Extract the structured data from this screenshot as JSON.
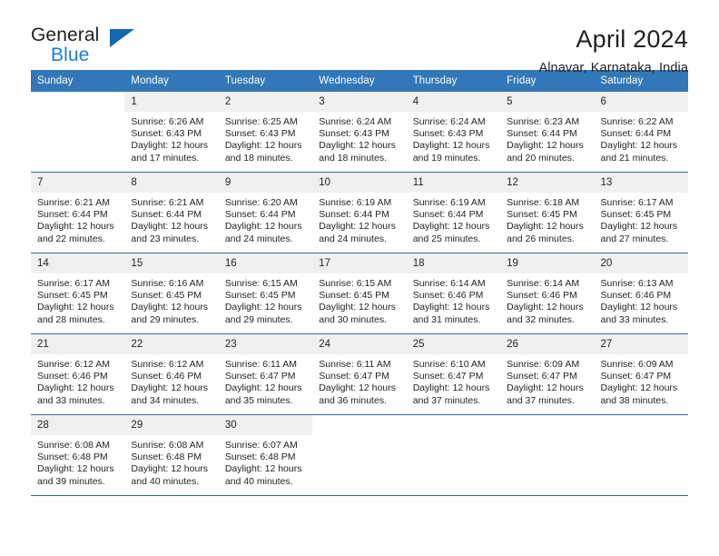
{
  "brand": {
    "name_top": "General",
    "name_bottom": "Blue",
    "triangle_color": "#1467ae",
    "blue_color": "#1b7fd1"
  },
  "header": {
    "title": "April 2024",
    "location": "Alnavar, Karnataka, India"
  },
  "theme": {
    "header_bg": "#3278b8",
    "row_divider": "#2e6da4",
    "daynum_bg": "#f0f0f0",
    "text": "#231f20"
  },
  "weekday_headers": [
    "Sunday",
    "Monday",
    "Tuesday",
    "Wednesday",
    "Thursday",
    "Friday",
    "Saturday"
  ],
  "weeks": [
    [
      {
        "day": "",
        "sunrise": "",
        "sunset": "",
        "daylight_line1": "",
        "daylight_line2": "",
        "blank": true
      },
      {
        "day": "1",
        "sunrise": "Sunrise: 6:26 AM",
        "sunset": "Sunset: 6:43 PM",
        "daylight_line1": "Daylight: 12 hours",
        "daylight_line2": "and 17 minutes."
      },
      {
        "day": "2",
        "sunrise": "Sunrise: 6:25 AM",
        "sunset": "Sunset: 6:43 PM",
        "daylight_line1": "Daylight: 12 hours",
        "daylight_line2": "and 18 minutes."
      },
      {
        "day": "3",
        "sunrise": "Sunrise: 6:24 AM",
        "sunset": "Sunset: 6:43 PM",
        "daylight_line1": "Daylight: 12 hours",
        "daylight_line2": "and 18 minutes."
      },
      {
        "day": "4",
        "sunrise": "Sunrise: 6:24 AM",
        "sunset": "Sunset: 6:43 PM",
        "daylight_line1": "Daylight: 12 hours",
        "daylight_line2": "and 19 minutes."
      },
      {
        "day": "5",
        "sunrise": "Sunrise: 6:23 AM",
        "sunset": "Sunset: 6:44 PM",
        "daylight_line1": "Daylight: 12 hours",
        "daylight_line2": "and 20 minutes."
      },
      {
        "day": "6",
        "sunrise": "Sunrise: 6:22 AM",
        "sunset": "Sunset: 6:44 PM",
        "daylight_line1": "Daylight: 12 hours",
        "daylight_line2": "and 21 minutes."
      }
    ],
    [
      {
        "day": "7",
        "sunrise": "Sunrise: 6:21 AM",
        "sunset": "Sunset: 6:44 PM",
        "daylight_line1": "Daylight: 12 hours",
        "daylight_line2": "and 22 minutes."
      },
      {
        "day": "8",
        "sunrise": "Sunrise: 6:21 AM",
        "sunset": "Sunset: 6:44 PM",
        "daylight_line1": "Daylight: 12 hours",
        "daylight_line2": "and 23 minutes."
      },
      {
        "day": "9",
        "sunrise": "Sunrise: 6:20 AM",
        "sunset": "Sunset: 6:44 PM",
        "daylight_line1": "Daylight: 12 hours",
        "daylight_line2": "and 24 minutes."
      },
      {
        "day": "10",
        "sunrise": "Sunrise: 6:19 AM",
        "sunset": "Sunset: 6:44 PM",
        "daylight_line1": "Daylight: 12 hours",
        "daylight_line2": "and 24 minutes."
      },
      {
        "day": "11",
        "sunrise": "Sunrise: 6:19 AM",
        "sunset": "Sunset: 6:44 PM",
        "daylight_line1": "Daylight: 12 hours",
        "daylight_line2": "and 25 minutes."
      },
      {
        "day": "12",
        "sunrise": "Sunrise: 6:18 AM",
        "sunset": "Sunset: 6:45 PM",
        "daylight_line1": "Daylight: 12 hours",
        "daylight_line2": "and 26 minutes."
      },
      {
        "day": "13",
        "sunrise": "Sunrise: 6:17 AM",
        "sunset": "Sunset: 6:45 PM",
        "daylight_line1": "Daylight: 12 hours",
        "daylight_line2": "and 27 minutes."
      }
    ],
    [
      {
        "day": "14",
        "sunrise": "Sunrise: 6:17 AM",
        "sunset": "Sunset: 6:45 PM",
        "daylight_line1": "Daylight: 12 hours",
        "daylight_line2": "and 28 minutes."
      },
      {
        "day": "15",
        "sunrise": "Sunrise: 6:16 AM",
        "sunset": "Sunset: 6:45 PM",
        "daylight_line1": "Daylight: 12 hours",
        "daylight_line2": "and 29 minutes."
      },
      {
        "day": "16",
        "sunrise": "Sunrise: 6:15 AM",
        "sunset": "Sunset: 6:45 PM",
        "daylight_line1": "Daylight: 12 hours",
        "daylight_line2": "and 29 minutes."
      },
      {
        "day": "17",
        "sunrise": "Sunrise: 6:15 AM",
        "sunset": "Sunset: 6:45 PM",
        "daylight_line1": "Daylight: 12 hours",
        "daylight_line2": "and 30 minutes."
      },
      {
        "day": "18",
        "sunrise": "Sunrise: 6:14 AM",
        "sunset": "Sunset: 6:46 PM",
        "daylight_line1": "Daylight: 12 hours",
        "daylight_line2": "and 31 minutes."
      },
      {
        "day": "19",
        "sunrise": "Sunrise: 6:14 AM",
        "sunset": "Sunset: 6:46 PM",
        "daylight_line1": "Daylight: 12 hours",
        "daylight_line2": "and 32 minutes."
      },
      {
        "day": "20",
        "sunrise": "Sunrise: 6:13 AM",
        "sunset": "Sunset: 6:46 PM",
        "daylight_line1": "Daylight: 12 hours",
        "daylight_line2": "and 33 minutes."
      }
    ],
    [
      {
        "day": "21",
        "sunrise": "Sunrise: 6:12 AM",
        "sunset": "Sunset: 6:46 PM",
        "daylight_line1": "Daylight: 12 hours",
        "daylight_line2": "and 33 minutes."
      },
      {
        "day": "22",
        "sunrise": "Sunrise: 6:12 AM",
        "sunset": "Sunset: 6:46 PM",
        "daylight_line1": "Daylight: 12 hours",
        "daylight_line2": "and 34 minutes."
      },
      {
        "day": "23",
        "sunrise": "Sunrise: 6:11 AM",
        "sunset": "Sunset: 6:47 PM",
        "daylight_line1": "Daylight: 12 hours",
        "daylight_line2": "and 35 minutes."
      },
      {
        "day": "24",
        "sunrise": "Sunrise: 6:11 AM",
        "sunset": "Sunset: 6:47 PM",
        "daylight_line1": "Daylight: 12 hours",
        "daylight_line2": "and 36 minutes."
      },
      {
        "day": "25",
        "sunrise": "Sunrise: 6:10 AM",
        "sunset": "Sunset: 6:47 PM",
        "daylight_line1": "Daylight: 12 hours",
        "daylight_line2": "and 37 minutes."
      },
      {
        "day": "26",
        "sunrise": "Sunrise: 6:09 AM",
        "sunset": "Sunset: 6:47 PM",
        "daylight_line1": "Daylight: 12 hours",
        "daylight_line2": "and 37 minutes."
      },
      {
        "day": "27",
        "sunrise": "Sunrise: 6:09 AM",
        "sunset": "Sunset: 6:47 PM",
        "daylight_line1": "Daylight: 12 hours",
        "daylight_line2": "and 38 minutes."
      }
    ],
    [
      {
        "day": "28",
        "sunrise": "Sunrise: 6:08 AM",
        "sunset": "Sunset: 6:48 PM",
        "daylight_line1": "Daylight: 12 hours",
        "daylight_line2": "and 39 minutes."
      },
      {
        "day": "29",
        "sunrise": "Sunrise: 6:08 AM",
        "sunset": "Sunset: 6:48 PM",
        "daylight_line1": "Daylight: 12 hours",
        "daylight_line2": "and 40 minutes."
      },
      {
        "day": "30",
        "sunrise": "Sunrise: 6:07 AM",
        "sunset": "Sunset: 6:48 PM",
        "daylight_line1": "Daylight: 12 hours",
        "daylight_line2": "and 40 minutes."
      },
      {
        "day": "",
        "sunrise": "",
        "sunset": "",
        "daylight_line1": "",
        "daylight_line2": "",
        "empty": true
      },
      {
        "day": "",
        "sunrise": "",
        "sunset": "",
        "daylight_line1": "",
        "daylight_line2": "",
        "empty": true
      },
      {
        "day": "",
        "sunrise": "",
        "sunset": "",
        "daylight_line1": "",
        "daylight_line2": "",
        "empty": true
      },
      {
        "day": "",
        "sunrise": "",
        "sunset": "",
        "daylight_line1": "",
        "daylight_line2": "",
        "blank": true
      }
    ]
  ]
}
